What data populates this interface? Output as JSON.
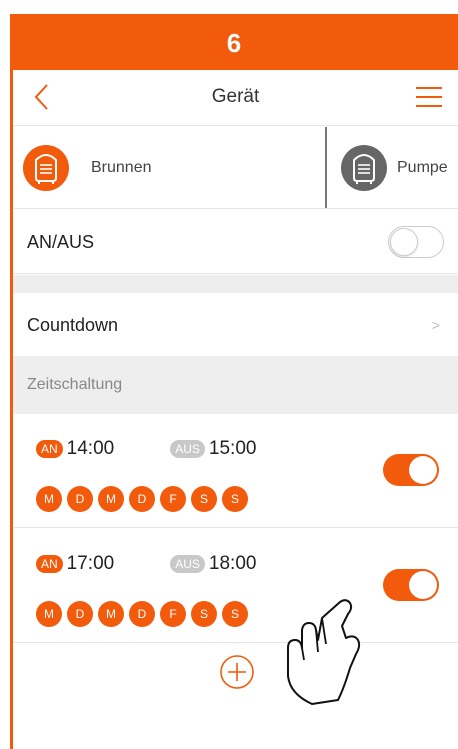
{
  "step_number": "6",
  "header": {
    "title": "Gerät",
    "back_icon": "chevron-left-icon",
    "menu_icon": "hamburger-menu-icon"
  },
  "devices": [
    {
      "label": "Brunnen",
      "icon": "fan-heater-icon",
      "active": true
    },
    {
      "label": "Pumpe",
      "icon": "fan-heater-icon",
      "active": false
    }
  ],
  "power": {
    "label": "AN/AUS",
    "enabled": false
  },
  "countdown": {
    "label": "Countdown"
  },
  "schedule": {
    "section_label": "Zeitschaltung",
    "timers": [
      {
        "on_tag": "AN",
        "on_time": "14:00",
        "off_tag": "AUS",
        "off_time": "15:00",
        "days": [
          "M",
          "D",
          "M",
          "D",
          "F",
          "S",
          "S"
        ],
        "enabled": true
      },
      {
        "on_tag": "AN",
        "on_time": "17:00",
        "off_tag": "AUS",
        "off_time": "18:00",
        "days": [
          "M",
          "D",
          "M",
          "D",
          "F",
          "S",
          "S"
        ],
        "enabled": true
      }
    ],
    "add_icon": "plus-circle-icon"
  },
  "colors": {
    "accent": "#f25a0c",
    "inactive": "#666666",
    "background": "#eeeeee"
  }
}
